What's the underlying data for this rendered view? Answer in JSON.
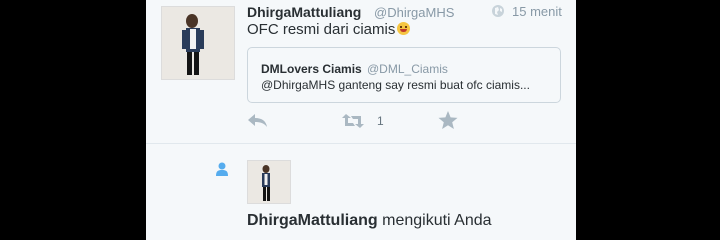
{
  "tweet": {
    "name": "DhirgaMattuliang",
    "handle": "@DhirgaMHS",
    "time": "15 menit",
    "text": "OFC resmi dari ciamis",
    "emoji": "smiling-face-emoji",
    "quote": {
      "name": "DMLovers Ciamis",
      "handle": "@DML_Ciamis",
      "text": "@DhirgaMHS ganteng say resmi buat ofc ciamis..."
    },
    "retweet_count": "1"
  },
  "follow": {
    "name": "DhirgaMattuliang",
    "text": " mengikuti Anda"
  },
  "icons": {
    "globe": "globe-icon",
    "reply": "reply-icon",
    "retweet": "retweet-icon",
    "favorite": "star-icon",
    "follow": "person-icon"
  },
  "colors": {
    "background": "#f5f8fa",
    "accent": "#55acee",
    "icon": "#aab8c2",
    "text": "#292f33",
    "secondary_text": "#8899a6"
  }
}
